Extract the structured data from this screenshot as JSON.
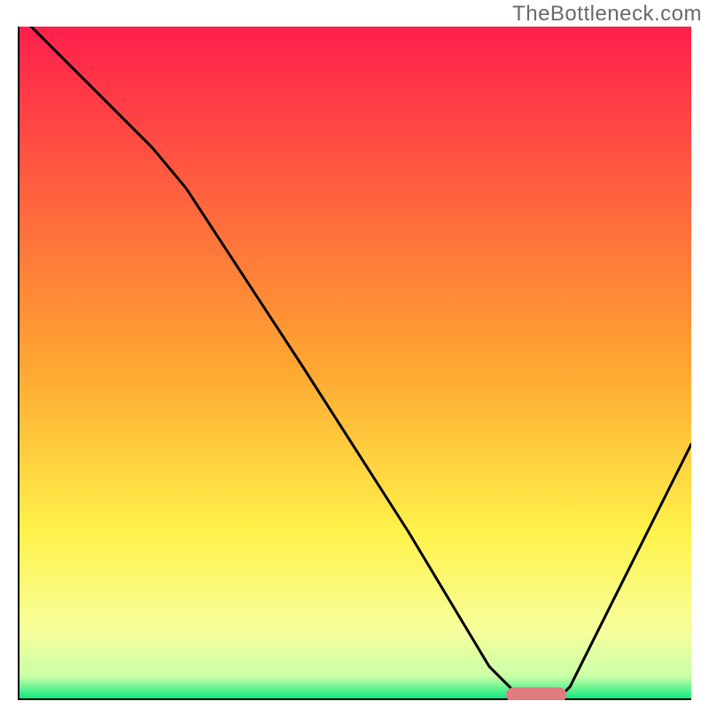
{
  "attribution": "TheBottleneck.com",
  "chart_data": {
    "type": "line",
    "title": "",
    "xlabel": "",
    "ylabel": "",
    "xlim": [
      0,
      100
    ],
    "ylim": [
      0,
      100
    ],
    "grid": false,
    "legend": false,
    "background_gradient": {
      "stops": [
        {
          "offset": 0.0,
          "color": "#ff1f4c"
        },
        {
          "offset": 0.5,
          "color": "#ffa531"
        },
        {
          "offset": 0.75,
          "color": "#fff24a"
        },
        {
          "offset": 0.9,
          "color": "#f6ff9d"
        },
        {
          "offset": 0.965,
          "color": "#c9ffa8"
        },
        {
          "offset": 1.0,
          "color": "#00e87a"
        }
      ]
    },
    "series": [
      {
        "name": "curve",
        "stroke": "#000000",
        "stroke_width": 3,
        "x": [
          2,
          10,
          20,
          25,
          42,
          58,
          70,
          75,
          80,
          82,
          88,
          100
        ],
        "y": [
          100,
          92,
          82,
          76,
          50,
          25,
          5,
          0,
          0,
          2,
          14,
          38
        ]
      }
    ],
    "marker": {
      "name": "minimum-marker",
      "shape": "pill",
      "x_center": 77,
      "y_center": 0.8,
      "width": 9,
      "height": 2.2,
      "fill": "#e17c7e"
    },
    "axes_color": "#000000"
  }
}
